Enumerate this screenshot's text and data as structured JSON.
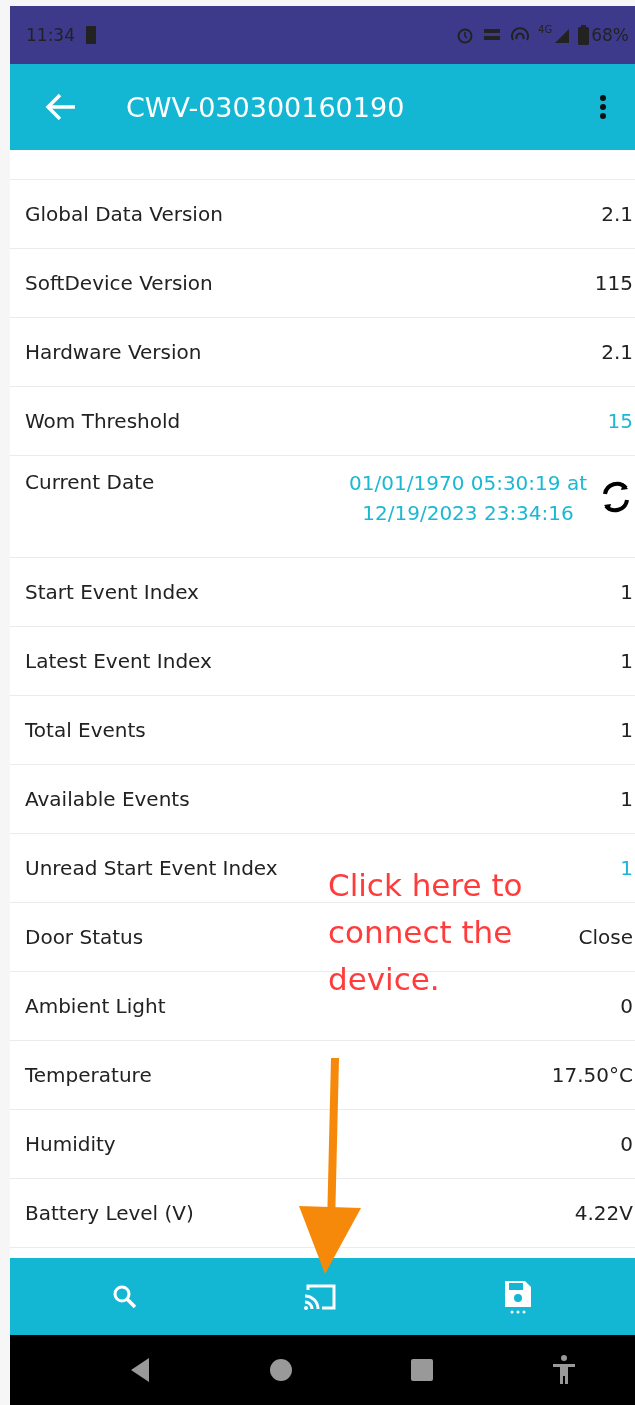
{
  "status_bar": {
    "time": "11:34",
    "network": "4G",
    "battery": "68%"
  },
  "app_bar": {
    "title": "CWV-030300160190"
  },
  "rows": [
    {
      "label": "Global Data Version",
      "value": "2.1",
      "kind": "plain"
    },
    {
      "label": "SoftDevice Version",
      "value": "115",
      "kind": "plain"
    },
    {
      "label": "Hardware Version",
      "value": "2.1",
      "kind": "plain"
    },
    {
      "label": "Wom Threshold",
      "value": "15",
      "kind": "link"
    },
    {
      "label": "Current Date",
      "value": "01/01/1970  05:30:19 at",
      "value_2": "12/19/2023  23:34:16",
      "kind": "date"
    },
    {
      "label": "Start Event Index",
      "value": "1",
      "kind": "plain"
    },
    {
      "label": "Latest Event Index",
      "value": "1",
      "kind": "plain"
    },
    {
      "label": "Total Events",
      "value": "1",
      "kind": "plain"
    },
    {
      "label": "Available Events",
      "value": "1",
      "kind": "plain"
    },
    {
      "label": "Unread Start Event Index",
      "value": "1",
      "kind": "link"
    },
    {
      "label": "Door Status",
      "value": "Close",
      "kind": "plain"
    },
    {
      "label": "Ambient Light",
      "value": "0",
      "kind": "plain"
    },
    {
      "label": "Temperature",
      "value": "17.50°C",
      "kind": "plain"
    },
    {
      "label": "Humidity",
      "value": "0",
      "kind": "plain"
    },
    {
      "label": "Battery Level (V)",
      "value": "4.22V",
      "kind": "plain"
    }
  ],
  "annotation": {
    "text": "Click here to connect the device."
  }
}
